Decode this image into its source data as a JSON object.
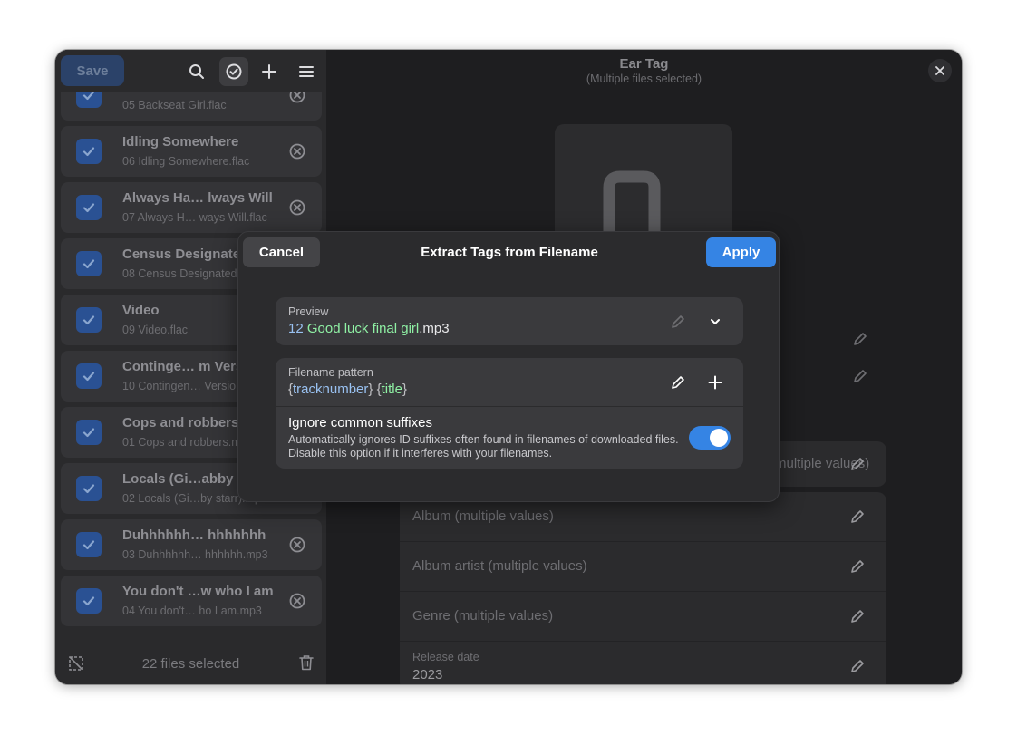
{
  "colors": {
    "accent": "#3584e4",
    "window_bg": "#1e1e20",
    "sidebar_bg": "#2a2a2c",
    "dialog_bg": "#2b2b2d",
    "pattern_placeholder": "#99c1f1",
    "pattern_title": "#8ff0a4"
  },
  "sidebar": {
    "save_label": "Save",
    "header_icons": [
      "search-icon",
      "select-all-icon",
      "add-icon",
      "menu-icon"
    ],
    "files": [
      {
        "title": "",
        "filename": "05 Backseat Girl.flac",
        "checked": true
      },
      {
        "title": "Idling Somewhere",
        "filename": "06 Idling Somewhere.flac",
        "checked": true
      },
      {
        "title": "Always Ha… lways Will",
        "filename": "07 Always H… ways Will.flac",
        "checked": true
      },
      {
        "title": "Census Designated",
        "filename": "08 Census Designated.flac",
        "checked": true
      },
      {
        "title": "Video",
        "filename": "09 Video.flac",
        "checked": true
      },
      {
        "title": "Continge… m Version",
        "filename": "10 Contingen… Version.flac",
        "checked": true
      },
      {
        "title": "Cops and robbers",
        "filename": "01 Cops and robbers.mp3",
        "checked": true
      },
      {
        "title": "Locals (Gi…abby",
        "filename": "02 Locals (Gi…by starr).mp3",
        "checked": true
      },
      {
        "title": "Duhhhhhh… hhhhhhh",
        "filename": "03 Duhhhhhh… hhhhhh.mp3",
        "checked": true
      },
      {
        "title": "You don't …w who I am",
        "filename": "04 You don't… ho I am.mp3",
        "checked": true
      }
    ],
    "footer_text": "22 files selected"
  },
  "main": {
    "title": "Ear Tag",
    "subtitle": "(Multiple files selected)",
    "partial_row": "(multiple values)",
    "props": [
      {
        "placeholder": "Album (multiple values)"
      },
      {
        "placeholder": "Album artist (multiple values)"
      },
      {
        "placeholder": "Genre (multiple values)"
      },
      {
        "label": "Release date",
        "value": "2023"
      }
    ]
  },
  "dialog": {
    "title": "Extract Tags from Filename",
    "cancel_label": "Cancel",
    "apply_label": "Apply",
    "preview": {
      "caption": "Preview",
      "track": "12",
      "title": "Good luck final girl",
      "ext": ".mp3"
    },
    "pattern": {
      "caption": "Filename pattern",
      "open_brace": "{",
      "close_brace": "}",
      "tracknumber": "tracknumber",
      "title": "title"
    },
    "ignore_suffixes": {
      "title": "Ignore common suffixes",
      "description": "Automatically ignores ID suffixes often found in filenames of downloaded files. Disable this option if it interferes with your filenames.",
      "enabled": true
    }
  }
}
